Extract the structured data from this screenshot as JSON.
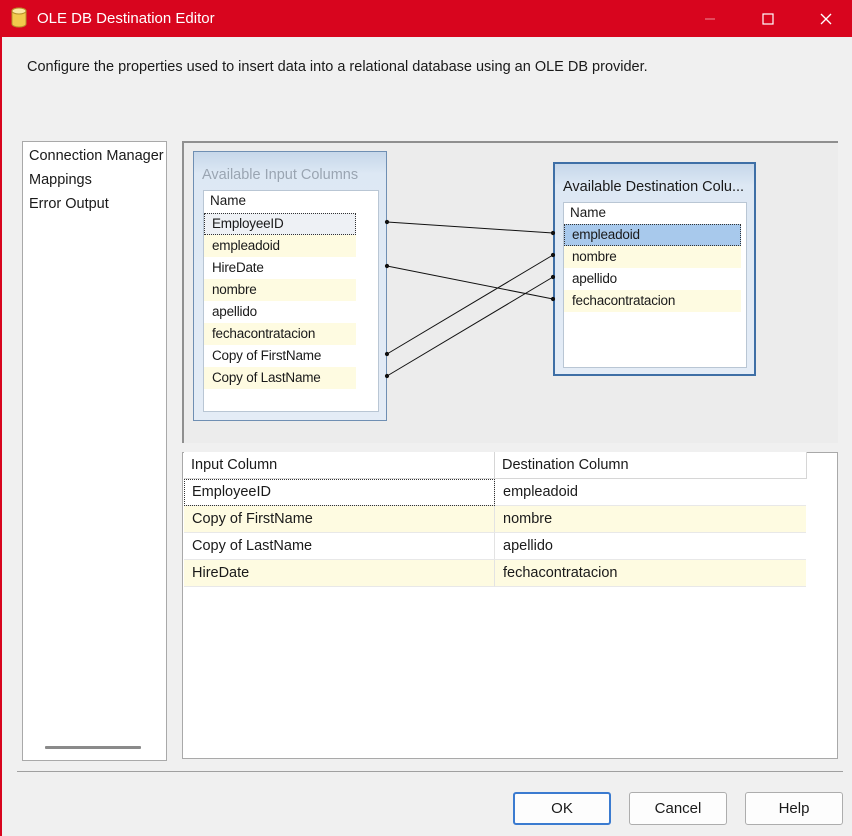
{
  "window": {
    "title": "OLE DB Destination Editor",
    "icon": "database-icon"
  },
  "description": "Configure the properties used to insert data into a relational database using an OLE DB provider.",
  "nav": {
    "items": [
      {
        "label": "Connection Manager"
      },
      {
        "label": "Mappings"
      },
      {
        "label": "Error Output"
      }
    ]
  },
  "input_panel": {
    "title": "Available Input Columns",
    "header": "Name",
    "columns": [
      "EmployeeID",
      "empleadoid",
      "HireDate",
      "nombre",
      "apellido",
      "fechacontratacion",
      "Copy of FirstName",
      "Copy of LastName"
    ]
  },
  "dest_panel": {
    "title": "Available Destination Colu...",
    "header": "Name",
    "columns": [
      "empleadoid",
      "nombre",
      "apellido",
      "fechacontratacion"
    ]
  },
  "mappings": {
    "headers": {
      "input": "Input Column",
      "destination": "Destination Column"
    },
    "rows": [
      {
        "input": "EmployeeID",
        "destination": "empleadoid"
      },
      {
        "input": "Copy of FirstName",
        "destination": "nombre"
      },
      {
        "input": "Copy of LastName",
        "destination": "apellido"
      },
      {
        "input": "HireDate",
        "destination": "fechacontratacion"
      }
    ]
  },
  "buttons": {
    "ok": "OK",
    "cancel": "Cancel",
    "help": "Help"
  },
  "colors": {
    "titlebar": "#d8051e",
    "row_alt": "#fefbe1",
    "selection": "#a8c9ec",
    "primary_border": "#3b7bd0"
  }
}
